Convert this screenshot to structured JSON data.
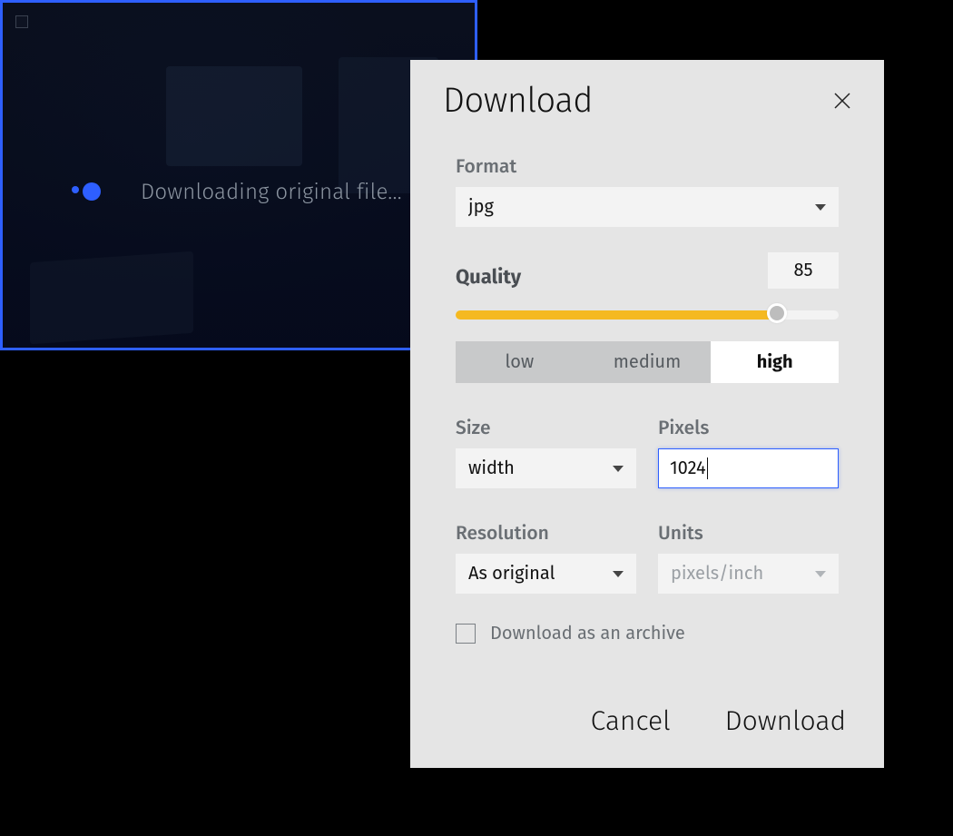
{
  "overlay": {
    "status_text": "Downloading original file..."
  },
  "dialog": {
    "title": "Download",
    "format": {
      "label": "Format",
      "value": "jpg"
    },
    "quality": {
      "label": "Quality",
      "value": "85",
      "percent": 84,
      "presets": {
        "low": "low",
        "medium": "medium",
        "high": "high",
        "active": "high"
      }
    },
    "size": {
      "label": "Size",
      "value": "width"
    },
    "pixels": {
      "label": "Pixels",
      "value": "1024"
    },
    "resolution": {
      "label": "Resolution",
      "value": "As original"
    },
    "units": {
      "label": "Units",
      "value": "pixels/inch"
    },
    "archive": {
      "label": "Download as an archive",
      "checked": false
    },
    "actions": {
      "cancel": "Cancel",
      "download": "Download"
    }
  }
}
